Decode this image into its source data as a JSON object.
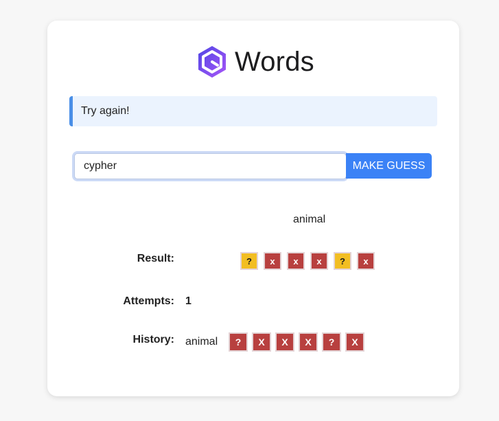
{
  "app": {
    "title": "Words"
  },
  "alert": {
    "message": "Try again!"
  },
  "guess": {
    "value": "cypher",
    "button_label": "MAKE GUESS"
  },
  "category": "animal",
  "result": {
    "label": "Result:",
    "tiles": [
      {
        "symbol": "?",
        "status": "present"
      },
      {
        "symbol": "x",
        "status": "absent"
      },
      {
        "symbol": "x",
        "status": "absent"
      },
      {
        "symbol": "x",
        "status": "absent"
      },
      {
        "symbol": "?",
        "status": "present"
      },
      {
        "symbol": "x",
        "status": "absent"
      }
    ]
  },
  "attempts": {
    "label": "Attempts:",
    "value": "1"
  },
  "history": {
    "label": "History:",
    "entries": [
      {
        "word": "animal",
        "tiles": [
          "?",
          "X",
          "X",
          "X",
          "?",
          "X"
        ]
      }
    ]
  },
  "colors": {
    "accent": "#3b82f6",
    "present": "#f2be22",
    "absent": "#b8403f",
    "alert_bg": "#ebf3fe",
    "alert_border": "#4a8fe7"
  },
  "icons": {
    "logo": "hexagon-logo-icon"
  }
}
